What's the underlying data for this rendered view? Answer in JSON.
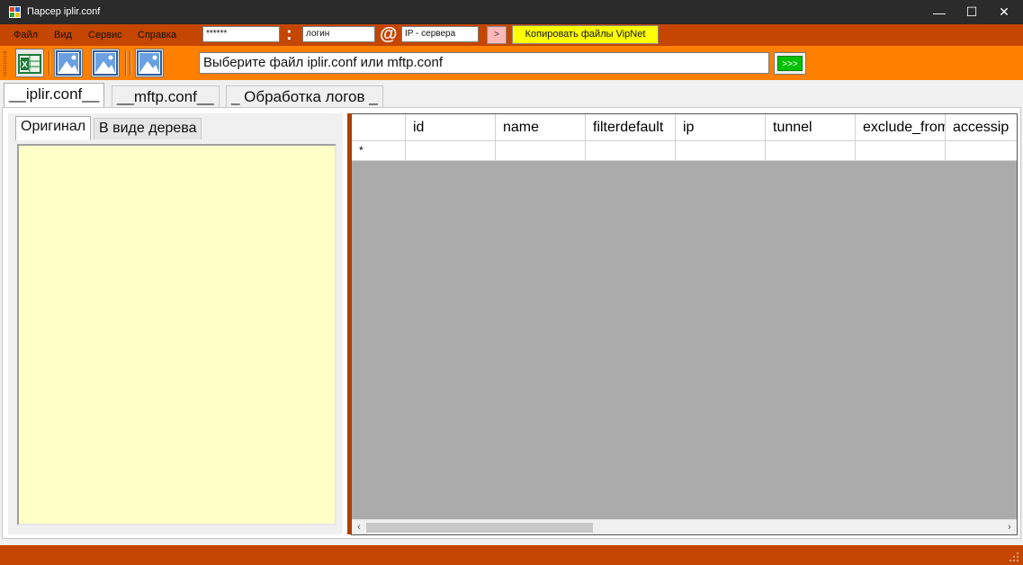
{
  "window": {
    "title": "Парсер iplir.conf"
  },
  "window_controls": {
    "minimize": "—",
    "maximize": "☐",
    "close": "✕"
  },
  "menu": {
    "items": [
      "Файл",
      "Вид",
      "Сервис",
      "Справка"
    ]
  },
  "connection": {
    "password_value": "******",
    "colon": ":",
    "login_value": "логин",
    "at": "@",
    "server_value": "IP - сервера",
    "go_label": ">",
    "copy_button_label": "Копировать файлы VipNet"
  },
  "toolbar": {
    "icons": [
      "excel-icon",
      "image-icon",
      "image-icon",
      "image-icon"
    ],
    "file_prompt": "Выберите файл iplir.conf  или  mftp.conf",
    "run_label": ">>>"
  },
  "tabs": [
    {
      "label": "__iplir.conf__",
      "active": true
    },
    {
      "label": "__mftp.conf__",
      "active": false
    },
    {
      "label": "_ Обработка логов _",
      "active": false
    }
  ],
  "left_panel": {
    "subtabs": [
      {
        "label": "Оригинал",
        "active": true
      },
      {
        "label": "В виде дерева",
        "active": false
      }
    ]
  },
  "grid": {
    "columns": [
      "",
      "id",
      "name",
      "filterdefault",
      "ip",
      "tunnel",
      "exclude_from",
      "accessip"
    ],
    "new_row_marker": "*"
  },
  "colors": {
    "menu_bar": "#c44600",
    "toolbar": "#ff8000",
    "copy_button": "#ffff00",
    "run_button": "#00c000",
    "text_area": "#ffffc8",
    "grid_background": "#ababab"
  }
}
